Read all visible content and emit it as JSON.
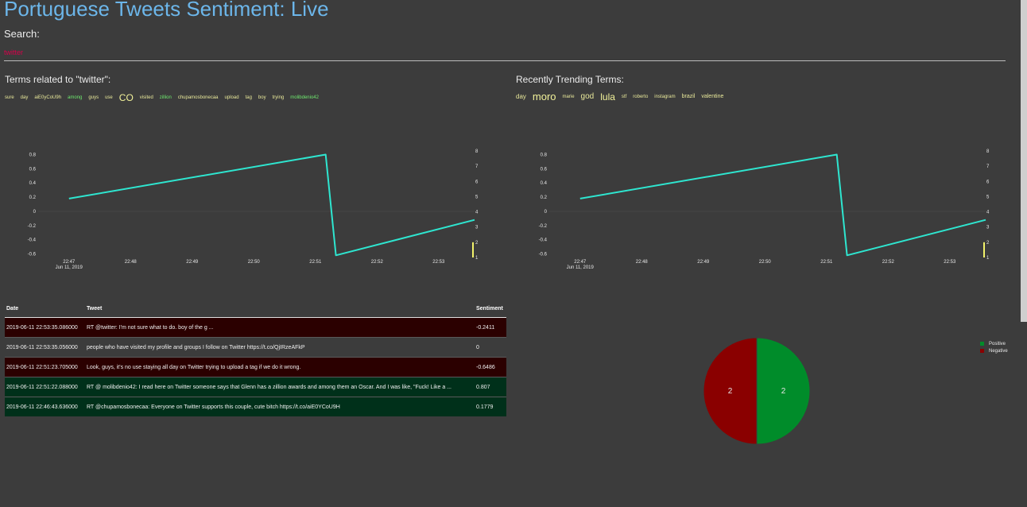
{
  "header": {
    "title": "Portuguese Tweets Sentiment: Live",
    "search_label": "Search:",
    "search_value": "twitter"
  },
  "related": {
    "heading": "Terms related to \"twitter\":",
    "terms": [
      {
        "text": "sure",
        "color": "#e8e89a",
        "size": 6
      },
      {
        "text": "day",
        "color": "#e8e89a",
        "size": 6
      },
      {
        "text": "aiE0yCoU9h",
        "color": "#e8e89a",
        "size": 6
      },
      {
        "text": "among",
        "color": "#6ee86e",
        "size": 6
      },
      {
        "text": "guys",
        "color": "#e8e89a",
        "size": 6
      },
      {
        "text": "use",
        "color": "#e8e89a",
        "size": 6
      },
      {
        "text": "CO",
        "color": "#f2f29a",
        "size": 12
      },
      {
        "text": "visited",
        "color": "#e8e89a",
        "size": 6
      },
      {
        "text": "zillion",
        "color": "#6ee86e",
        "size": 6
      },
      {
        "text": "chupamosbonecaa",
        "color": "#e8e89a",
        "size": 6
      },
      {
        "text": "upload",
        "color": "#e8e89a",
        "size": 6
      },
      {
        "text": "tag",
        "color": "#e8e89a",
        "size": 6
      },
      {
        "text": "boy",
        "color": "#e8e89a",
        "size": 6
      },
      {
        "text": "trying",
        "color": "#e8e89a",
        "size": 6
      },
      {
        "text": "molibdenio42",
        "color": "#6ee86e",
        "size": 6
      }
    ]
  },
  "trending": {
    "heading": "Recently Trending Terms:",
    "terms": [
      {
        "text": "day",
        "color": "#e8e89a",
        "size": 8
      },
      {
        "text": "moro",
        "color": "#f2f29a",
        "size": 13
      },
      {
        "text": "marie",
        "color": "#e8e89a",
        "size": 6
      },
      {
        "text": "god",
        "color": "#e8e89a",
        "size": 10
      },
      {
        "text": "lula",
        "color": "#f2f29a",
        "size": 12
      },
      {
        "text": "stf",
        "color": "#e8e89a",
        "size": 6
      },
      {
        "text": "roberto",
        "color": "#e8e89a",
        "size": 6
      },
      {
        "text": "instagram",
        "color": "#e8e89a",
        "size": 6
      },
      {
        "text": "brazil",
        "color": "#e8e89a",
        "size": 7
      },
      {
        "text": "valentine",
        "color": "#e8e89a",
        "size": 7
      }
    ]
  },
  "chart_data": [
    {
      "type": "line",
      "x": [
        "22:47:00",
        "22:51:10",
        "22:51:20",
        "22:53:35"
      ],
      "series": [
        {
          "values": [
            0.18,
            0.8,
            -0.62,
            -0.12
          ],
          "color": "#2ee6d0"
        }
      ],
      "xticks": [
        "22:47",
        "22:48",
        "22:49",
        "22:50",
        "22:51",
        "22:52",
        "22:53"
      ],
      "x_date_label": "Jun 11, 2019",
      "yticks": [
        0.8,
        0.6,
        0.4,
        0.2,
        0,
        -0.2,
        -0.4,
        -0.6
      ],
      "ylim": [
        -0.65,
        0.85
      ],
      "y2ticks": [
        8,
        7,
        6,
        5,
        4,
        3,
        2,
        1
      ],
      "y2lim": [
        1,
        8
      ],
      "volume": {
        "x": "22:53:35",
        "value": 2,
        "color": "#f2f26a"
      },
      "grid": false
    },
    {
      "type": "line",
      "x": [
        "22:47:00",
        "22:51:10",
        "22:51:20",
        "22:53:35"
      ],
      "series": [
        {
          "values": [
            0.18,
            0.8,
            -0.62,
            -0.12
          ],
          "color": "#2ee6d0"
        }
      ],
      "xticks": [
        "22:47",
        "22:48",
        "22:49",
        "22:50",
        "22:51",
        "22:52",
        "22:53"
      ],
      "x_date_label": "Jun 11, 2019",
      "yticks": [
        0.8,
        0.6,
        0.4,
        0.2,
        0,
        -0.2,
        -0.4,
        -0.6
      ],
      "ylim": [
        -0.65,
        0.85
      ],
      "y2ticks": [
        8,
        7,
        6,
        5,
        4,
        3,
        2,
        1
      ],
      "y2lim": [
        1,
        8
      ],
      "volume": {
        "x": "22:53:35",
        "value": 2,
        "color": "#f2f26a"
      },
      "grid": false
    },
    {
      "type": "pie",
      "labels": [
        "Positive",
        "Negative"
      ],
      "values": [
        2,
        2
      ],
      "colors": [
        "#008c2a",
        "#8a0000"
      ],
      "legend": "top-right"
    },
    {
      "type": "table",
      "columns": [
        "Date",
        "Tweet",
        "Sentiment"
      ],
      "rows": [
        {
          "date": "2019-06-11 22:53:35.086000",
          "tweet": "RT @twitter: I'm not sure what to do. boy of the g ...",
          "sentiment": "-0.2411",
          "bg": "#2b0000"
        },
        {
          "date": "2019-06-11 22:53:35.056000",
          "tweet": "people who have visited my profile and groups I follow on Twitter https://t.co/QjIRzeAFkP",
          "sentiment": "0",
          "bg": "#3c3c3c"
        },
        {
          "date": "2019-06-11 22:51:23.705000",
          "tweet": "Look, guys, it's no use staying all day on Twitter trying to upload a tag if we do it wrong.",
          "sentiment": "-0.6486",
          "bg": "#2b0000"
        },
        {
          "date": "2019-06-11 22:51:22.088000",
          "tweet": "RT @ molibdenio42: I read here on Twitter someone says that Glenn has a zillion awards and among them an Oscar. And I was like, \"Fuck! Like a ...",
          "sentiment": "0.807",
          "bg": "#00301a"
        },
        {
          "date": "2019-06-11 22:46:43.636000",
          "tweet": "RT @chupamosbonecaa: Everyone on Twitter supports this couple, cute bitch https://t.co/aiE0YCoU9H",
          "sentiment": "0.1779",
          "bg": "#00301a"
        }
      ]
    }
  ]
}
